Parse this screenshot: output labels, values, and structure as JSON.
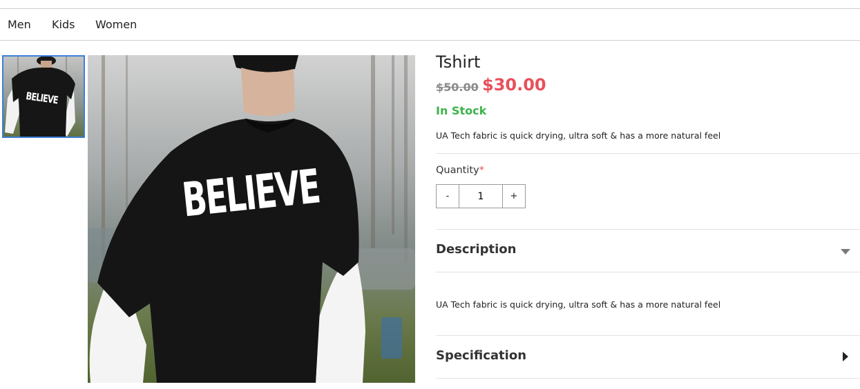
{
  "nav": {
    "items": [
      {
        "label": "Men"
      },
      {
        "label": "Kids"
      },
      {
        "label": "Women"
      }
    ]
  },
  "gallery": {
    "thumbnail_text": "BELIEVE",
    "main_text": "BELIEVE"
  },
  "product": {
    "title": "Tshirt",
    "old_price": "$50.00",
    "new_price": "$30.00",
    "stock_status": "In Stock",
    "short_description": "UA Tech fabric is quick drying, ultra soft & has a more natural feel",
    "quantity_label": "Quantity",
    "quantity_required_mark": "*",
    "quantity": {
      "minus": "-",
      "value": "1",
      "plus": "+"
    }
  },
  "sections": {
    "description": {
      "title": "Description",
      "body": "UA Tech fabric is quick drying, ultra soft & has a more natural feel",
      "expanded": true
    },
    "specification": {
      "title": "Specification",
      "expanded": false
    }
  },
  "colors": {
    "sale_price": "#e8505b",
    "in_stock": "#3db34a",
    "thumbnail_border": "#3d7fd9"
  }
}
